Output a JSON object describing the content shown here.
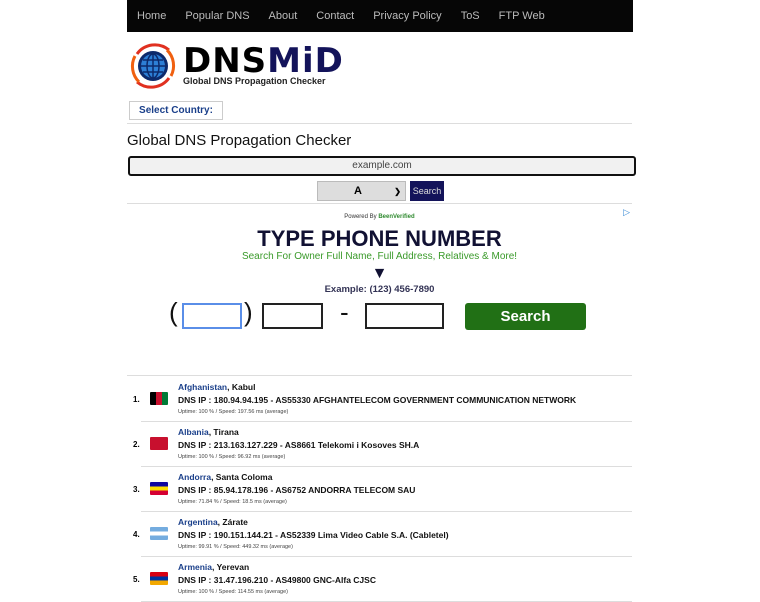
{
  "nav": [
    "Home",
    "Popular DNS",
    "About",
    "Contact",
    "Privacy Policy",
    "ToS",
    "FTP Web"
  ],
  "logo": {
    "part1": "DNS",
    "part2": "MiD",
    "tagline": "Global DNS Propagation Checker"
  },
  "select_country": "Select Country:",
  "title": "Global DNS Propagation Checker",
  "domain_input": {
    "value": "example.com"
  },
  "record_type": "A",
  "search_label": "Search",
  "ad": {
    "powered": "Powered By",
    "brand": "BeenVerified",
    "headline": "TYPE PHONE NUMBER",
    "sub": "Search For Owner Full Name, Full Address, Relatives & More!",
    "arrow": "▼",
    "example": "Example: (123) 456-7890",
    "button": "Search",
    "open_paren": "(",
    "close_paren": ")",
    "dash": "-"
  },
  "results": [
    {
      "num": "1.",
      "country": "Afghanistan",
      "city": ", Kabul",
      "ip": "DNS IP : 180.94.94.195 - AS55330 AFGHANTELECOM GOVERNMENT COMMUNICATION NETWORK",
      "stats": "Uptime: 100 % / Speed: 197.56 ms (average)",
      "flag": [
        "#000000",
        "#c8102e",
        "#007a36"
      ]
    },
    {
      "num": "2.",
      "country": "Albania",
      "city": ", Tirana",
      "ip": "DNS IP : 213.163.127.229 - AS8661 Telekomi i Kosoves SH.A",
      "stats": "Uptime: 100 % / Speed: 96.92 ms (average)",
      "flag": [
        "#c8102e",
        "#c8102e",
        "#c8102e"
      ]
    },
    {
      "num": "3.",
      "country": "Andorra",
      "city": ", Santa Coloma",
      "ip": "DNS IP : 85.94.178.196 - AS6752 ANDORRA TELECOM SAU",
      "stats": "Uptime: 71.84 % / Speed: 18.5 ms (average)",
      "flag": [
        "#10069f",
        "#fedd00",
        "#d50032"
      ]
    },
    {
      "num": "4.",
      "country": "Argentina",
      "city": ", Zárate",
      "ip": "DNS IP : 190.151.144.21 - AS52339 Lima Video Cable S.A. (Cabletel)",
      "stats": "Uptime: 99.91 % / Speed: 449.32 ms (average)",
      "flag": [
        "#74acdf",
        "#ffffff",
        "#74acdf"
      ]
    },
    {
      "num": "5.",
      "country": "Armenia",
      "city": ", Yerevan",
      "ip": "DNS IP : 31.47.196.210 - AS49800 GNC-Alfa CJSC",
      "stats": "Uptime: 100 % / Speed: 114.55 ms (average)",
      "flag": [
        "#d90012",
        "#0033a0",
        "#f2a800"
      ]
    }
  ]
}
